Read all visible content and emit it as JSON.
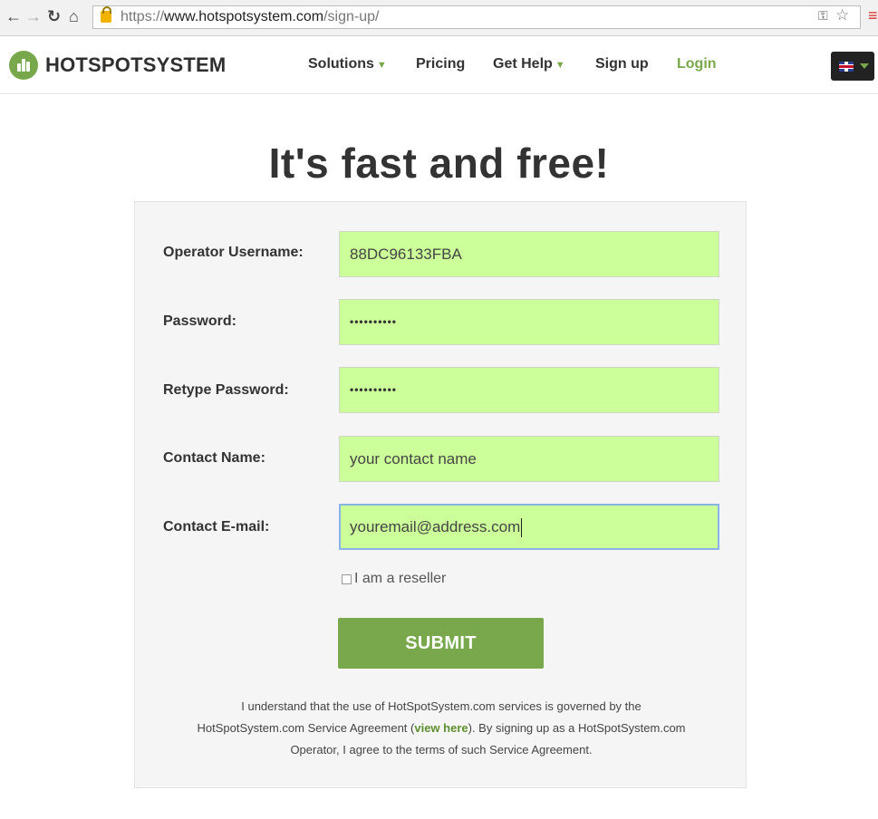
{
  "browser": {
    "url_scheme": "https://",
    "url_host": "www.hotspotsystem.com",
    "url_path": "/sign-up/"
  },
  "header": {
    "logo_text": "HOTSPOTSYSTEM",
    "nav": {
      "solutions": "Solutions",
      "pricing": "Pricing",
      "get_help": "Get Help",
      "sign_up": "Sign up",
      "login": "Login"
    },
    "caret": "▼"
  },
  "page": {
    "title": "It's fast and free!"
  },
  "form": {
    "username_label": "Operator Username:",
    "username_value": "88DC96133FBA",
    "password_label": "Password:",
    "password_value": "••••••••••",
    "retype_label": "Retype Password:",
    "retype_value": "••••••••••",
    "contact_name_label": "Contact Name:",
    "contact_name_value": "your contact name",
    "contact_email_label": "Contact E-mail:",
    "contact_email_value": "youremail@address.com",
    "reseller_label": "I am a reseller",
    "reseller_checked": false,
    "submit_label": "SUBMIT"
  },
  "agreement": {
    "line1": "I understand that the use of HotSpotSystem.com services is governed by the",
    "line2a": "HotSpotSystem.com Service Agreement (",
    "link": "view here",
    "line2b": "). By signing up as a HotSpotSystem.com",
    "line3": "Operator, I agree to the terms of such Service Agreement."
  },
  "colors": {
    "brand_green": "#78a84b",
    "field_bg": "#ccff99",
    "panel_bg": "#f5f5f5"
  }
}
